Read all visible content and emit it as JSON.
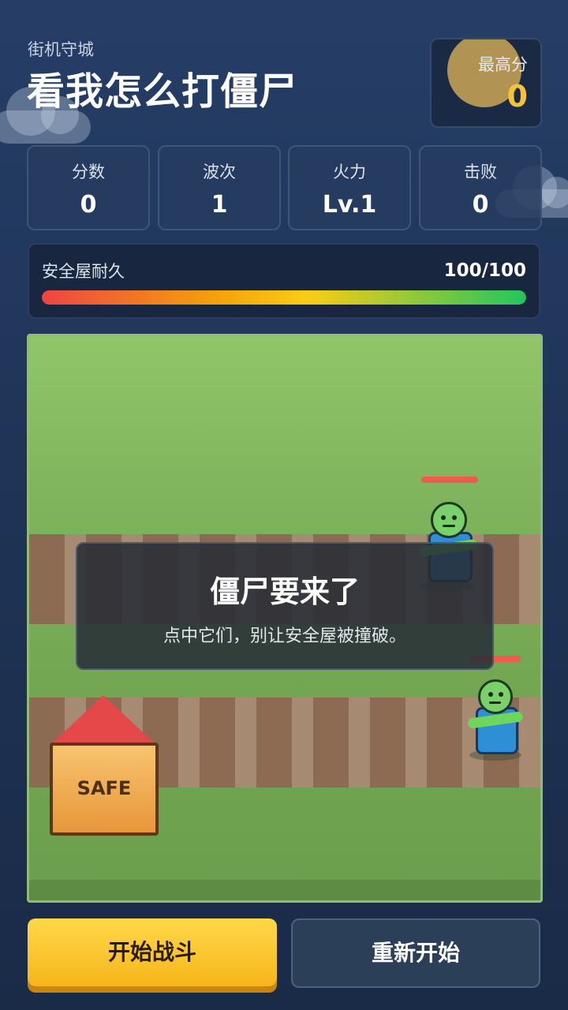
{
  "header": {
    "subtitle": "街机守城",
    "title": "看我怎么打僵尸",
    "best_score": {
      "label": "最高分",
      "value": "0"
    }
  },
  "stats": [
    {
      "label": "分数",
      "value": "0"
    },
    {
      "label": "波次",
      "value": "1"
    },
    {
      "label": "火力",
      "value": "Lv.1"
    },
    {
      "label": "击败",
      "value": "0"
    }
  ],
  "safehouse_hp": {
    "label": "安全屋耐久",
    "value_text": "100/100",
    "current": 100,
    "max": 100
  },
  "battlefield": {
    "safe_label": "SAFE",
    "overlay": {
      "title": "僵尸要来了",
      "subtitle": "点中它们，别让安全屋被撞破。"
    }
  },
  "buttons": {
    "start": "开始战斗",
    "restart": "重新开始"
  },
  "colors": {
    "accent_gold": "#f5c33b",
    "start_button": "#f6b51a",
    "safe_roof": "#e54848",
    "zombie_skin": "#7ad06b",
    "zombie_shirt": "#2e8ed6"
  }
}
